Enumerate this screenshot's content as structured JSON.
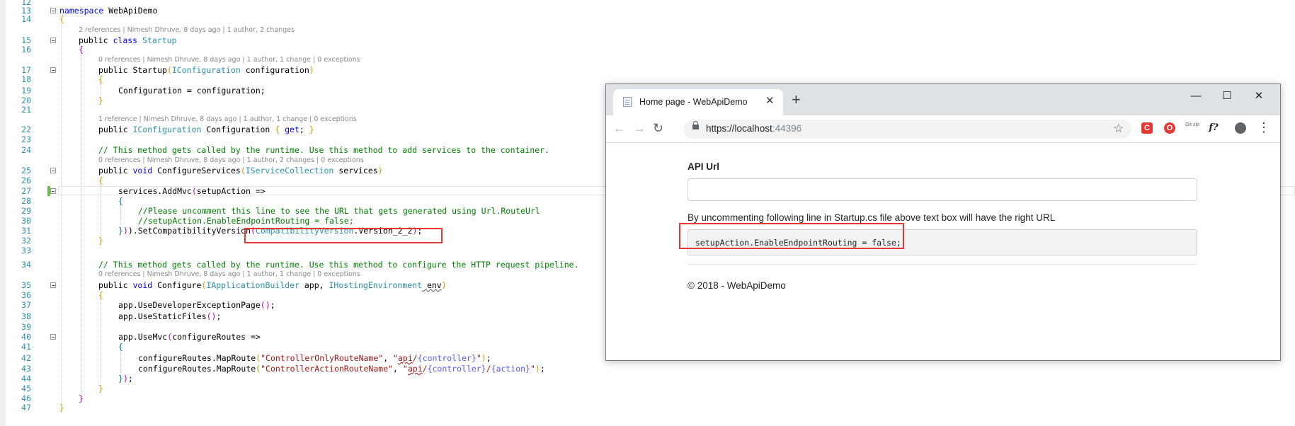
{
  "editor": {
    "line_numbers": [
      "12",
      "13",
      "14",
      "15",
      "16",
      "17",
      "18",
      "19",
      "20",
      "21",
      "22",
      "23",
      "24",
      "25",
      "26",
      "27",
      "28",
      "29",
      "30",
      "31",
      "32",
      "33",
      "34",
      "35",
      "36",
      "37",
      "38",
      "39",
      "40",
      "41",
      "42",
      "43",
      "44",
      "45",
      "46",
      "47"
    ],
    "lines": {
      "l13": {
        "kw": "namespace",
        "name": " WebApiDemo"
      },
      "l14": "{",
      "lens15": "2 references | Nimesh Dhruve, 8 days ago | 1 author, 2 changes",
      "l15": {
        "kw1": "public ",
        "kw2": "class ",
        "name": "Startup"
      },
      "l16": "{",
      "lens17": "0 references | Nimesh Dhruve, 8 days ago | 1 author, 1 change | 0 exceptions",
      "l17": {
        "a": "public Startup",
        "b": "(",
        "type": "IConfiguration",
        "c": " configuration",
        "d": ")"
      },
      "l18": "{",
      "l19": "Configuration = configuration;",
      "l20": "}",
      "lens22": "1 reference | Nimesh Dhruve, 8 days ago | 1 author, 1 change | 0 exceptions",
      "l22": {
        "a": "public ",
        "type": "IConfiguration",
        "b": " Configuration ",
        "c": "{",
        "kw": " get",
        "d": "; ",
        "e": "}"
      },
      "l24": "// This method gets called by the runtime. Use this method to add services to the container.",
      "lens25": "0 references | Nimesh Dhruve, 8 days ago | 1 author, 2 changes | 0 exceptions",
      "l25": {
        "a": "public ",
        "kw": "void",
        "b": " ConfigureServices",
        "c": "(",
        "type": "IServiceCollection",
        "d": " services",
        "e": ")"
      },
      "l26": "{",
      "l27": {
        "a": "services.AddMvc",
        "b": "(",
        "c": "setupAction =>"
      },
      "l28": "{",
      "l29": "//Please uncomment this line to see the URL that gets generated using Url.RouteUrl",
      "l30": "//setupAction.EnableEndpointRouting = false;",
      "l31": {
        "a": "}",
        "b": ").SetCompatibilityVersion",
        "c": "(",
        "type": "CompatibilityVersion",
        "d": ".Version_2_2",
        "e": ")",
        "f": ";"
      },
      "l32": "}",
      "l34": "// This method gets called by the runtime. Use this method to configure the HTTP request pipeline.",
      "lens35": "0 references | Nimesh Dhruve, 8 days ago | 1 author, 1 change | 0 exceptions",
      "l35": {
        "a": "public ",
        "kw": "void",
        "b": " Configure",
        "c": "(",
        "type1": "IApplicationBuilder",
        "d": " app, ",
        "type2": "IHostingEnvironment",
        "e": " env",
        "f": ")"
      },
      "l36": "{",
      "l37": {
        "a": "app.UseDeveloperExceptionPage",
        "b": "()",
        "c": ";"
      },
      "l38": {
        "a": "app.UseStaticFiles",
        "b": "()",
        "c": ";"
      },
      "l40": {
        "a": "app.UseMvc",
        "b": "(",
        "c": "configureRoutes =>"
      },
      "l41": "{",
      "l42": {
        "a": "configureRoutes.MapRoute",
        "b": "(",
        "s1": "\"ControllerOnlyRouteName\"",
        "c": ", ",
        "s2a": "\"",
        "s2b": "api",
        "s2c": "/",
        "f1": "{controller}",
        "s2d": "\"",
        "d": ")",
        "e": ";"
      },
      "l43": {
        "a": "configureRoutes.MapRoute",
        "b": "(",
        "s1": "\"ControllerActionRouteName\"",
        "c": ", ",
        "s2a": "\"",
        "s2b": "api",
        "s2c": "/",
        "f1": "{controller}",
        "s2e": "/",
        "f2": "{action}",
        "s2d": "\"",
        "d": ")",
        "e": ";"
      },
      "l44": {
        "a": "}",
        "b": ")",
        "c": ";"
      },
      "l45": "}",
      "l46": "}",
      "l47": "}"
    }
  },
  "browser": {
    "tab_title": "Home page - WebApiDemo",
    "tab_close": "✕",
    "new_tab": "+",
    "window_buttons": {
      "minimize": "—",
      "maximize": "☐",
      "close": "✕"
    },
    "nav": {
      "back": "←",
      "forward": "→",
      "reload": "↻"
    },
    "url_host": "https://localhost",
    "url_port": ":44396",
    "star": "☆",
    "extensions": [
      "C",
      "O",
      "Git zip",
      "f?"
    ],
    "menu": "⋮",
    "page": {
      "label": "API Url",
      "input_value": "",
      "hint": "By uncommenting following line in Startup.cs file above text box will have the right URL",
      "code": "setupAction.EnableEndpointRouting = false;",
      "footer": "© 2018 - WebApiDemo"
    }
  },
  "colors": {
    "keyword": "#0000ff",
    "type": "#2b91af",
    "comment": "#008000",
    "string": "#a31515",
    "highlight_box": "#e53935"
  }
}
